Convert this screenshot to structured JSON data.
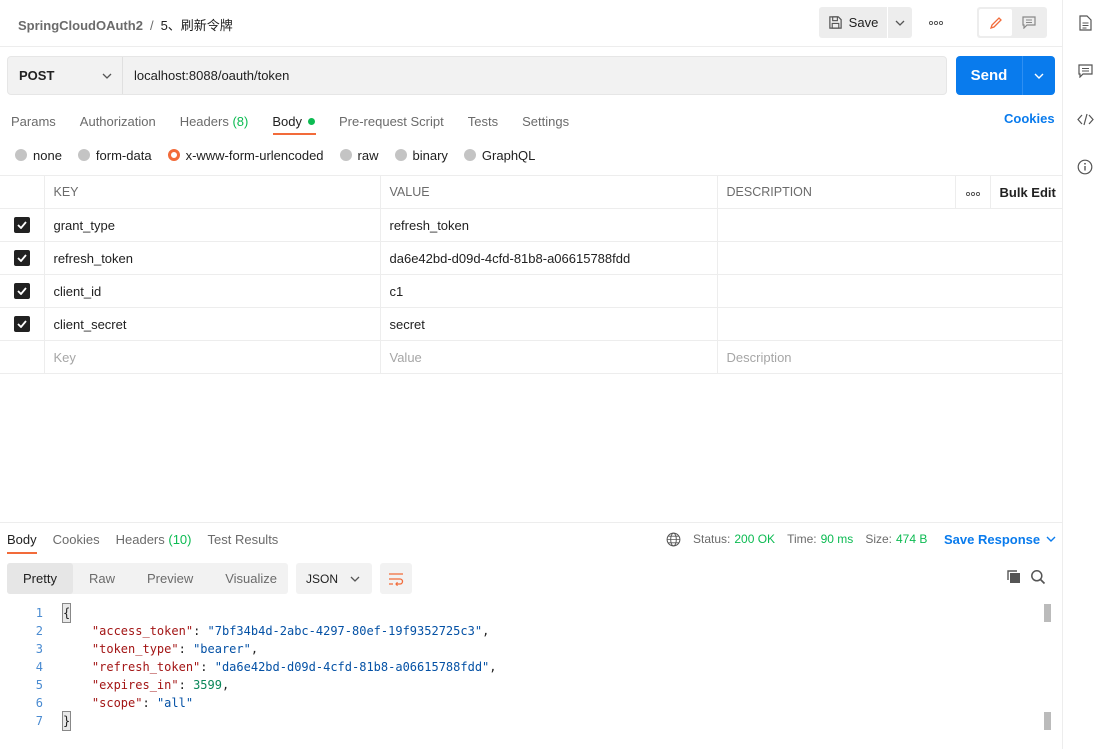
{
  "breadcrumb": {
    "collection": "SpringCloudOAuth2",
    "separator": "/",
    "request": "5、刷新令牌"
  },
  "toolbar": {
    "save_label": "Save"
  },
  "request": {
    "method": "POST",
    "url": "localhost:8088/oauth/token",
    "send_label": "Send"
  },
  "req_tabs": [
    {
      "label": "Params"
    },
    {
      "label": "Authorization"
    },
    {
      "label": "Headers",
      "count": "(8)"
    },
    {
      "label": "Body"
    },
    {
      "label": "Pre-request Script"
    },
    {
      "label": "Tests"
    },
    {
      "label": "Settings"
    }
  ],
  "cookies_label": "Cookies",
  "body_types": [
    {
      "label": "none",
      "checked": false
    },
    {
      "label": "form-data",
      "checked": false
    },
    {
      "label": "x-www-form-urlencoded",
      "checked": true
    },
    {
      "label": "raw",
      "checked": false
    },
    {
      "label": "binary",
      "checked": false
    },
    {
      "label": "GraphQL",
      "checked": false
    }
  ],
  "params_table": {
    "headers": {
      "key": "KEY",
      "value": "VALUE",
      "description": "DESCRIPTION",
      "bulk_edit": "Bulk Edit"
    },
    "rows": [
      {
        "key": "grant_type",
        "value": "refresh_token",
        "description": ""
      },
      {
        "key": "refresh_token",
        "value": "da6e42bd-d09d-4cfd-81b8-a06615788fdd",
        "description": ""
      },
      {
        "key": "client_id",
        "value": "c1",
        "description": ""
      },
      {
        "key": "client_secret",
        "value": "secret",
        "description": ""
      }
    ],
    "placeholders": {
      "key": "Key",
      "value": "Value",
      "description": "Description"
    }
  },
  "response": {
    "tabs": [
      {
        "label": "Body"
      },
      {
        "label": "Cookies"
      },
      {
        "label": "Headers",
        "count": "(10)"
      },
      {
        "label": "Test Results"
      }
    ],
    "status_label": "Status:",
    "status_value": "200 OK",
    "time_label": "Time:",
    "time_value": "90 ms",
    "size_label": "Size:",
    "size_value": "474 B",
    "save_response_label": "Save Response",
    "view_tabs": [
      "Pretty",
      "Raw",
      "Preview",
      "Visualize"
    ],
    "format": "JSON",
    "lines": [
      {
        "n": "1",
        "parts": [
          {
            "t": "{",
            "c": "brace"
          }
        ]
      },
      {
        "n": "2",
        "parts": [
          {
            "t": "    "
          },
          {
            "t": "\"access_token\"",
            "c": "key"
          },
          {
            "t": ": "
          },
          {
            "t": "\"7bf34b4d-2abc-4297-80ef-19f9352725c3\"",
            "c": "str"
          },
          {
            "t": ","
          }
        ]
      },
      {
        "n": "3",
        "parts": [
          {
            "t": "    "
          },
          {
            "t": "\"token_type\"",
            "c": "key"
          },
          {
            "t": ": "
          },
          {
            "t": "\"bearer\"",
            "c": "str"
          },
          {
            "t": ","
          }
        ]
      },
      {
        "n": "4",
        "parts": [
          {
            "t": "    "
          },
          {
            "t": "\"refresh_token\"",
            "c": "key"
          },
          {
            "t": ": "
          },
          {
            "t": "\"da6e42bd-d09d-4cfd-81b8-a06615788fdd\"",
            "c": "str"
          },
          {
            "t": ","
          }
        ]
      },
      {
        "n": "5",
        "parts": [
          {
            "t": "    "
          },
          {
            "t": "\"expires_in\"",
            "c": "key"
          },
          {
            "t": ": "
          },
          {
            "t": "3599",
            "c": "num"
          },
          {
            "t": ","
          }
        ]
      },
      {
        "n": "6",
        "parts": [
          {
            "t": "    "
          },
          {
            "t": "\"scope\"",
            "c": "key"
          },
          {
            "t": ": "
          },
          {
            "t": "\"all\"",
            "c": "str"
          }
        ]
      },
      {
        "n": "7",
        "parts": [
          {
            "t": "}",
            "c": "brace"
          }
        ]
      }
    ]
  },
  "colors": {
    "accent": "#f26b3a",
    "primary": "#097bed",
    "success": "#0cbb52"
  },
  "icons": [
    "save-icon",
    "chevron-down-icon",
    "more-icon",
    "edit-icon",
    "comment-icon",
    "document-icon",
    "code-icon",
    "info-icon",
    "globe-icon",
    "copy-icon",
    "search-icon",
    "wrap-icon"
  ]
}
